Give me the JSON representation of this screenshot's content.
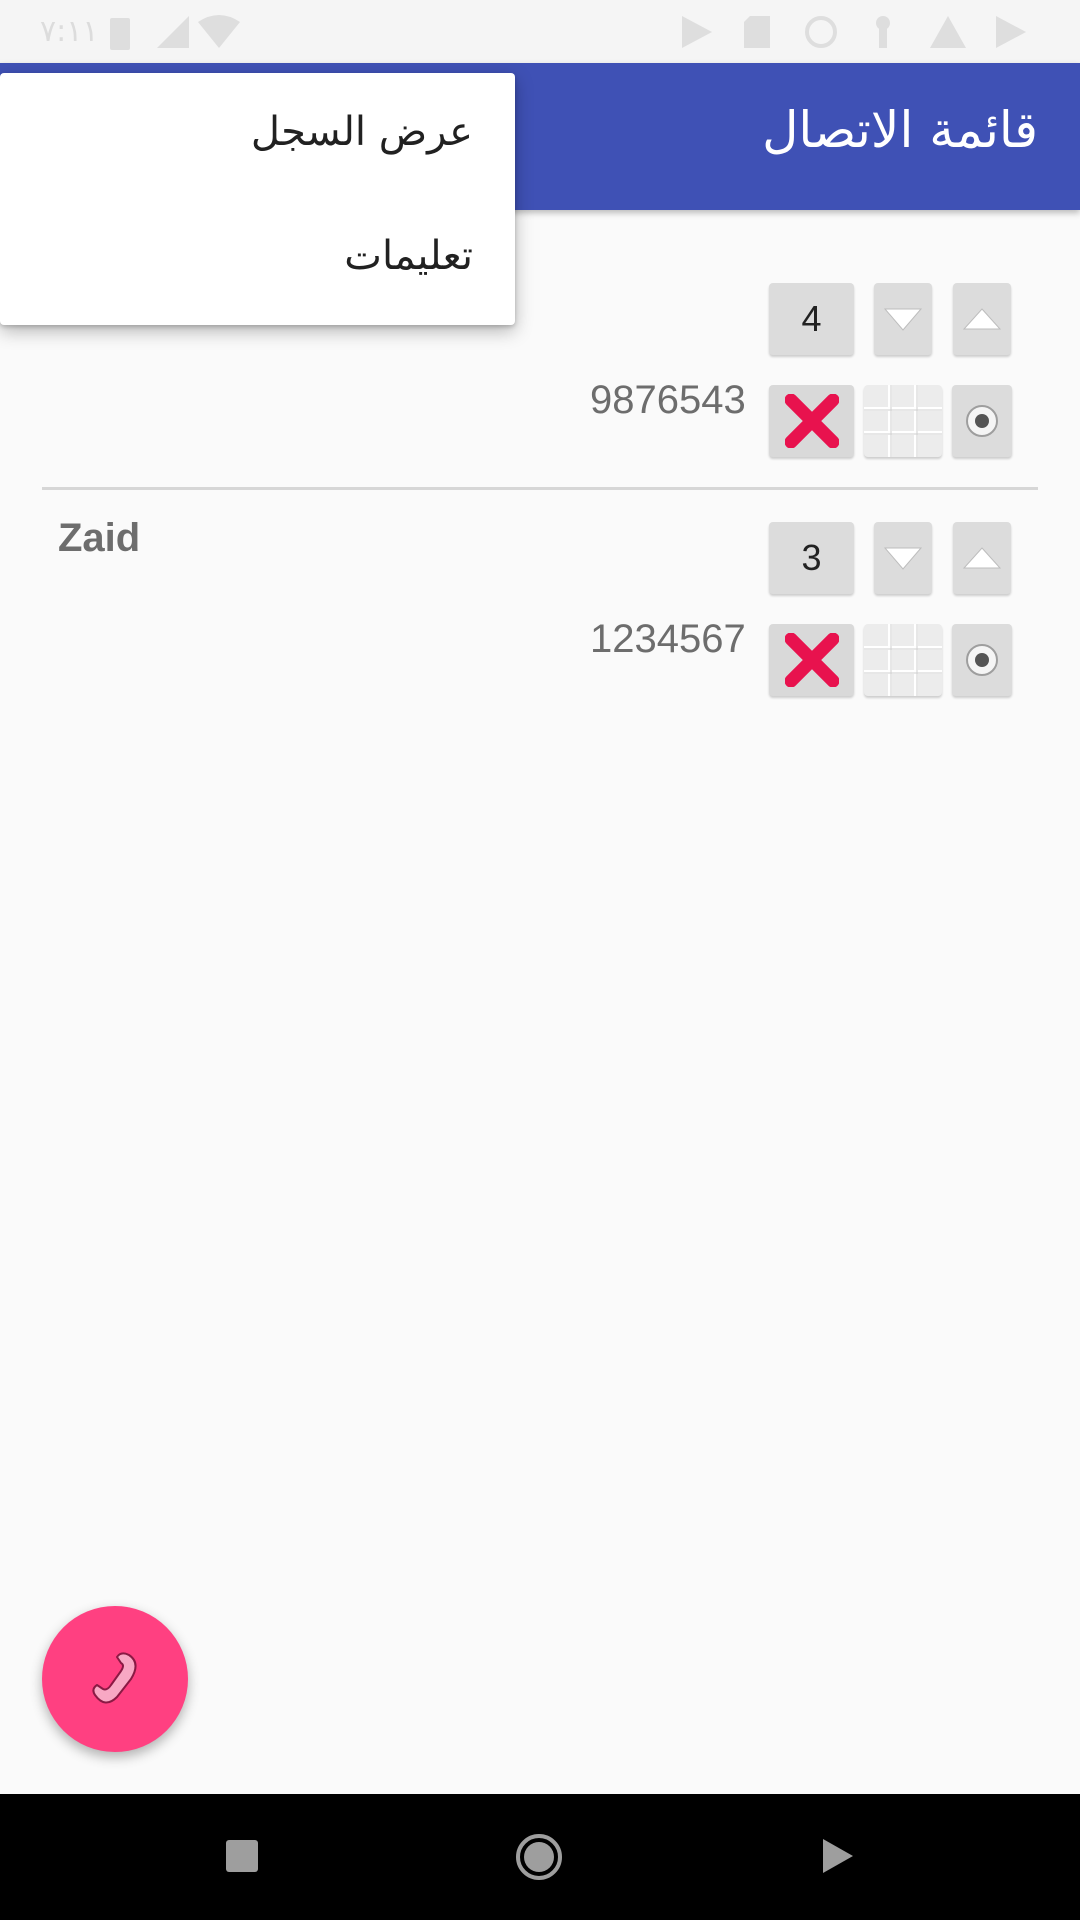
{
  "status_bar": {
    "time": "٧:١١"
  },
  "app_bar": {
    "title": "قائمة الاتصال"
  },
  "menu": {
    "items": [
      {
        "label": "عرض السجل"
      },
      {
        "label": "تعليمات"
      }
    ]
  },
  "contacts": [
    {
      "name": "",
      "order": "4",
      "number": "9876543"
    },
    {
      "name": "Zaid",
      "order": "3",
      "number": "1234567"
    }
  ],
  "colors": {
    "primary": "#3f51b5",
    "accent": "#ff4081",
    "delete": "#e8124e"
  },
  "icons": {
    "fab": "phone-icon",
    "row_buttons": [
      "radio-icon",
      "dialpad-grid-icon",
      "delete-x-icon",
      "arrow-up-icon",
      "arrow-down-icon"
    ],
    "nav": [
      "recents-square-icon",
      "home-circle-icon",
      "back-triangle-icon"
    ]
  }
}
